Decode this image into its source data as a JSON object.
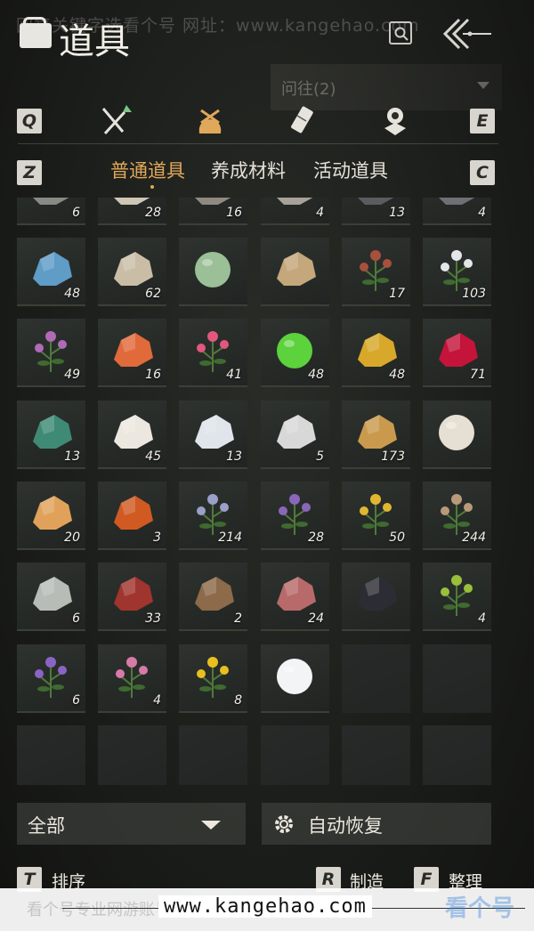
{
  "watermark": {
    "top_text": "回复关键字选看个号   网址：www.kangehao.com",
    "bottom_url": "www.kangehao.com",
    "bottom_ghost": "看个号专业网游账号 安全 有保障",
    "logo_text": "看个号"
  },
  "header": {
    "title": "道具",
    "search_icon": "search-icon",
    "back_icon": "back-arrows-icon",
    "follow_label": "问往(2)"
  },
  "categories": {
    "left_key": "Q",
    "right_key": "E",
    "icons": [
      "swords-icon",
      "pouch-icon",
      "scroll-icon",
      "badge-icon"
    ],
    "active_index": 1,
    "active_color": "#e0a85a"
  },
  "subtabs": {
    "left_key": "Z",
    "right_key": "C",
    "items": [
      "普通道具",
      "养成材料",
      "活动道具"
    ],
    "active_index": 0
  },
  "items": [
    {
      "count": "6",
      "icon": "bones-icon"
    },
    {
      "count": "28",
      "icon": "fur-icon"
    },
    {
      "count": "16",
      "icon": "ore-icon"
    },
    {
      "count": "4",
      "icon": "stone-icon"
    },
    {
      "count": "13",
      "icon": "dark-ore-icon"
    },
    {
      "count": "4",
      "icon": "rock-icon"
    },
    {
      "count": "48",
      "icon": "blue-crystal-icon"
    },
    {
      "count": "62",
      "icon": "bone-spine-icon"
    },
    {
      "count": "",
      "icon": "melon-icon"
    },
    {
      "count": "",
      "icon": "rice-sacks-icon"
    },
    {
      "count": "17",
      "icon": "red-berry-branch-icon"
    },
    {
      "count": "103",
      "icon": "white-flower-icon"
    },
    {
      "count": "49",
      "icon": "purple-clover-icon"
    },
    {
      "count": "16",
      "icon": "koi-fish-icon"
    },
    {
      "count": "41",
      "icon": "pink-flower-icon"
    },
    {
      "count": "48",
      "icon": "green-orb-icon"
    },
    {
      "count": "48",
      "icon": "gold-nugget-icon"
    },
    {
      "count": "71",
      "icon": "red-crystal-icon"
    },
    {
      "count": "13",
      "icon": "green-gravel-icon"
    },
    {
      "count": "45",
      "icon": "white-mushroom-icon"
    },
    {
      "count": "13",
      "icon": "jar-icon"
    },
    {
      "count": "5",
      "icon": "feather-icon"
    },
    {
      "count": "173",
      "icon": "gold-ingot-icon"
    },
    {
      "count": "",
      "icon": "milk-bowl-icon"
    },
    {
      "count": "20",
      "icon": "amber-chunks-icon"
    },
    {
      "count": "3",
      "icon": "orange-stone-icon"
    },
    {
      "count": "214",
      "icon": "spider-lily-icon"
    },
    {
      "count": "28",
      "icon": "lavender-spike-icon"
    },
    {
      "count": "50",
      "icon": "yellow-herb-icon"
    },
    {
      "count": "244",
      "icon": "ginseng-icon"
    },
    {
      "count": "6",
      "icon": "fish-icon"
    },
    {
      "count": "33",
      "icon": "wine-jar-icon"
    },
    {
      "count": "2",
      "icon": "straw-icon"
    },
    {
      "count": "24",
      "icon": "meat-icon"
    },
    {
      "count": "",
      "icon": "coal-icon"
    },
    {
      "count": "4",
      "icon": "bush-icon"
    },
    {
      "count": "6",
      "icon": "purple-spike-icon"
    },
    {
      "count": "4",
      "icon": "pink-blossom-icon"
    },
    {
      "count": "8",
      "icon": "yellow-blossom-icon"
    },
    {
      "count": "",
      "icon": "snowball-icon"
    },
    {
      "count": "",
      "icon": ""
    },
    {
      "count": "",
      "icon": ""
    },
    {
      "count": "",
      "icon": ""
    },
    {
      "count": "",
      "icon": ""
    },
    {
      "count": "",
      "icon": ""
    },
    {
      "count": "",
      "icon": ""
    },
    {
      "count": "",
      "icon": ""
    },
    {
      "count": "",
      "icon": ""
    }
  ],
  "bottom": {
    "filter_label": "全部",
    "auto_recover_label": "自动恢复",
    "sort_key": "T",
    "sort_label": "排序",
    "craft_key": "R",
    "craft_label": "制造",
    "arrange_key": "F",
    "arrange_label": "整理"
  }
}
